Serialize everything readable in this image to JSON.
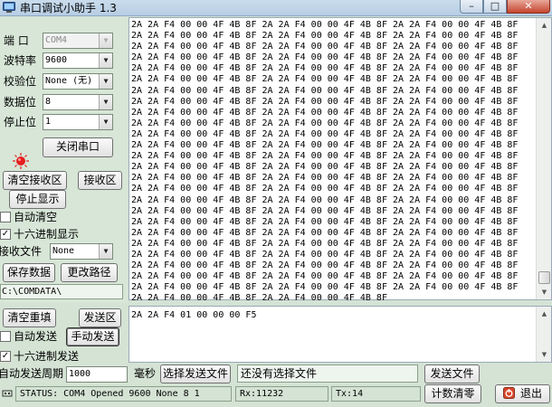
{
  "window": {
    "title": "串口调试小助手 1.3",
    "minimize_glyph": "–",
    "maximize_glyph": "□",
    "close_glyph": "✕"
  },
  "serial_settings": {
    "port_label": "端  口",
    "port_value": "COM4",
    "baud_label": "波特率",
    "baud_value": "9600",
    "parity_label": "校验位",
    "parity_value": "None (无)",
    "databits_label": "数据位",
    "databits_value": "8",
    "stopbits_label": "停止位",
    "stopbits_value": "1",
    "close_port_label": "关闭串口",
    "port_status": "open"
  },
  "receive": {
    "clear_label": "清空接收区",
    "area_label": "接收区",
    "stop_display_label": "停止显示",
    "auto_clear_label": "自动清空",
    "auto_clear_checked": false,
    "hex_display_label": "十六进制显示",
    "hex_display_checked": true,
    "file_label": "接收文件",
    "file_value": "None",
    "save_data_label": "保存数据",
    "change_path_label": "更改路径",
    "path": "C:\\COMDATA\\",
    "full_line": "2A 2A F4 00 00 4F 4B 8F 2A 2A F4 00 00 4F 4B 8F 2A 2A F4 00 00 4F 4B 8F",
    "last_line": "2A 2A F4 00 00 4F 4B 8F 2A 2A F4 00 00 4F 4B 8F",
    "full_line_count": 25
  },
  "send": {
    "clear_label": "清空重填",
    "area_label": "发送区",
    "auto_send_label": "自动发送",
    "auto_send_checked": false,
    "manual_send_label": "手动发送",
    "hex_send_label": "十六进制发送",
    "hex_send_checked": true,
    "period_label": "自动发送周期",
    "period_value": "1000",
    "period_unit": "毫秒",
    "choose_file_label": "选择发送文件",
    "no_file_text": "还没有选择文件",
    "send_file_label": "发送文件",
    "content": "2A 2A F4 01 00 00 00 F5"
  },
  "status": {
    "status_text": "STATUS: COM4 Opened 9600 None  8  1",
    "rx_text": "Rx:11232",
    "tx_text": "Tx:14",
    "clear_count_label": "计数清零",
    "exit_label": "退出"
  },
  "glyphs": {
    "check": "✓",
    "dropdown": "▼",
    "scroll_up": "▲",
    "scroll_down": "▼"
  },
  "colors": {
    "panel_bg": "#d4e3d4",
    "led_red": "#e61e1e",
    "close_button": "#c4452f"
  },
  "icons": [
    "app-icon",
    "led-indicator-icon",
    "status-port-icon",
    "exit-icon"
  ]
}
